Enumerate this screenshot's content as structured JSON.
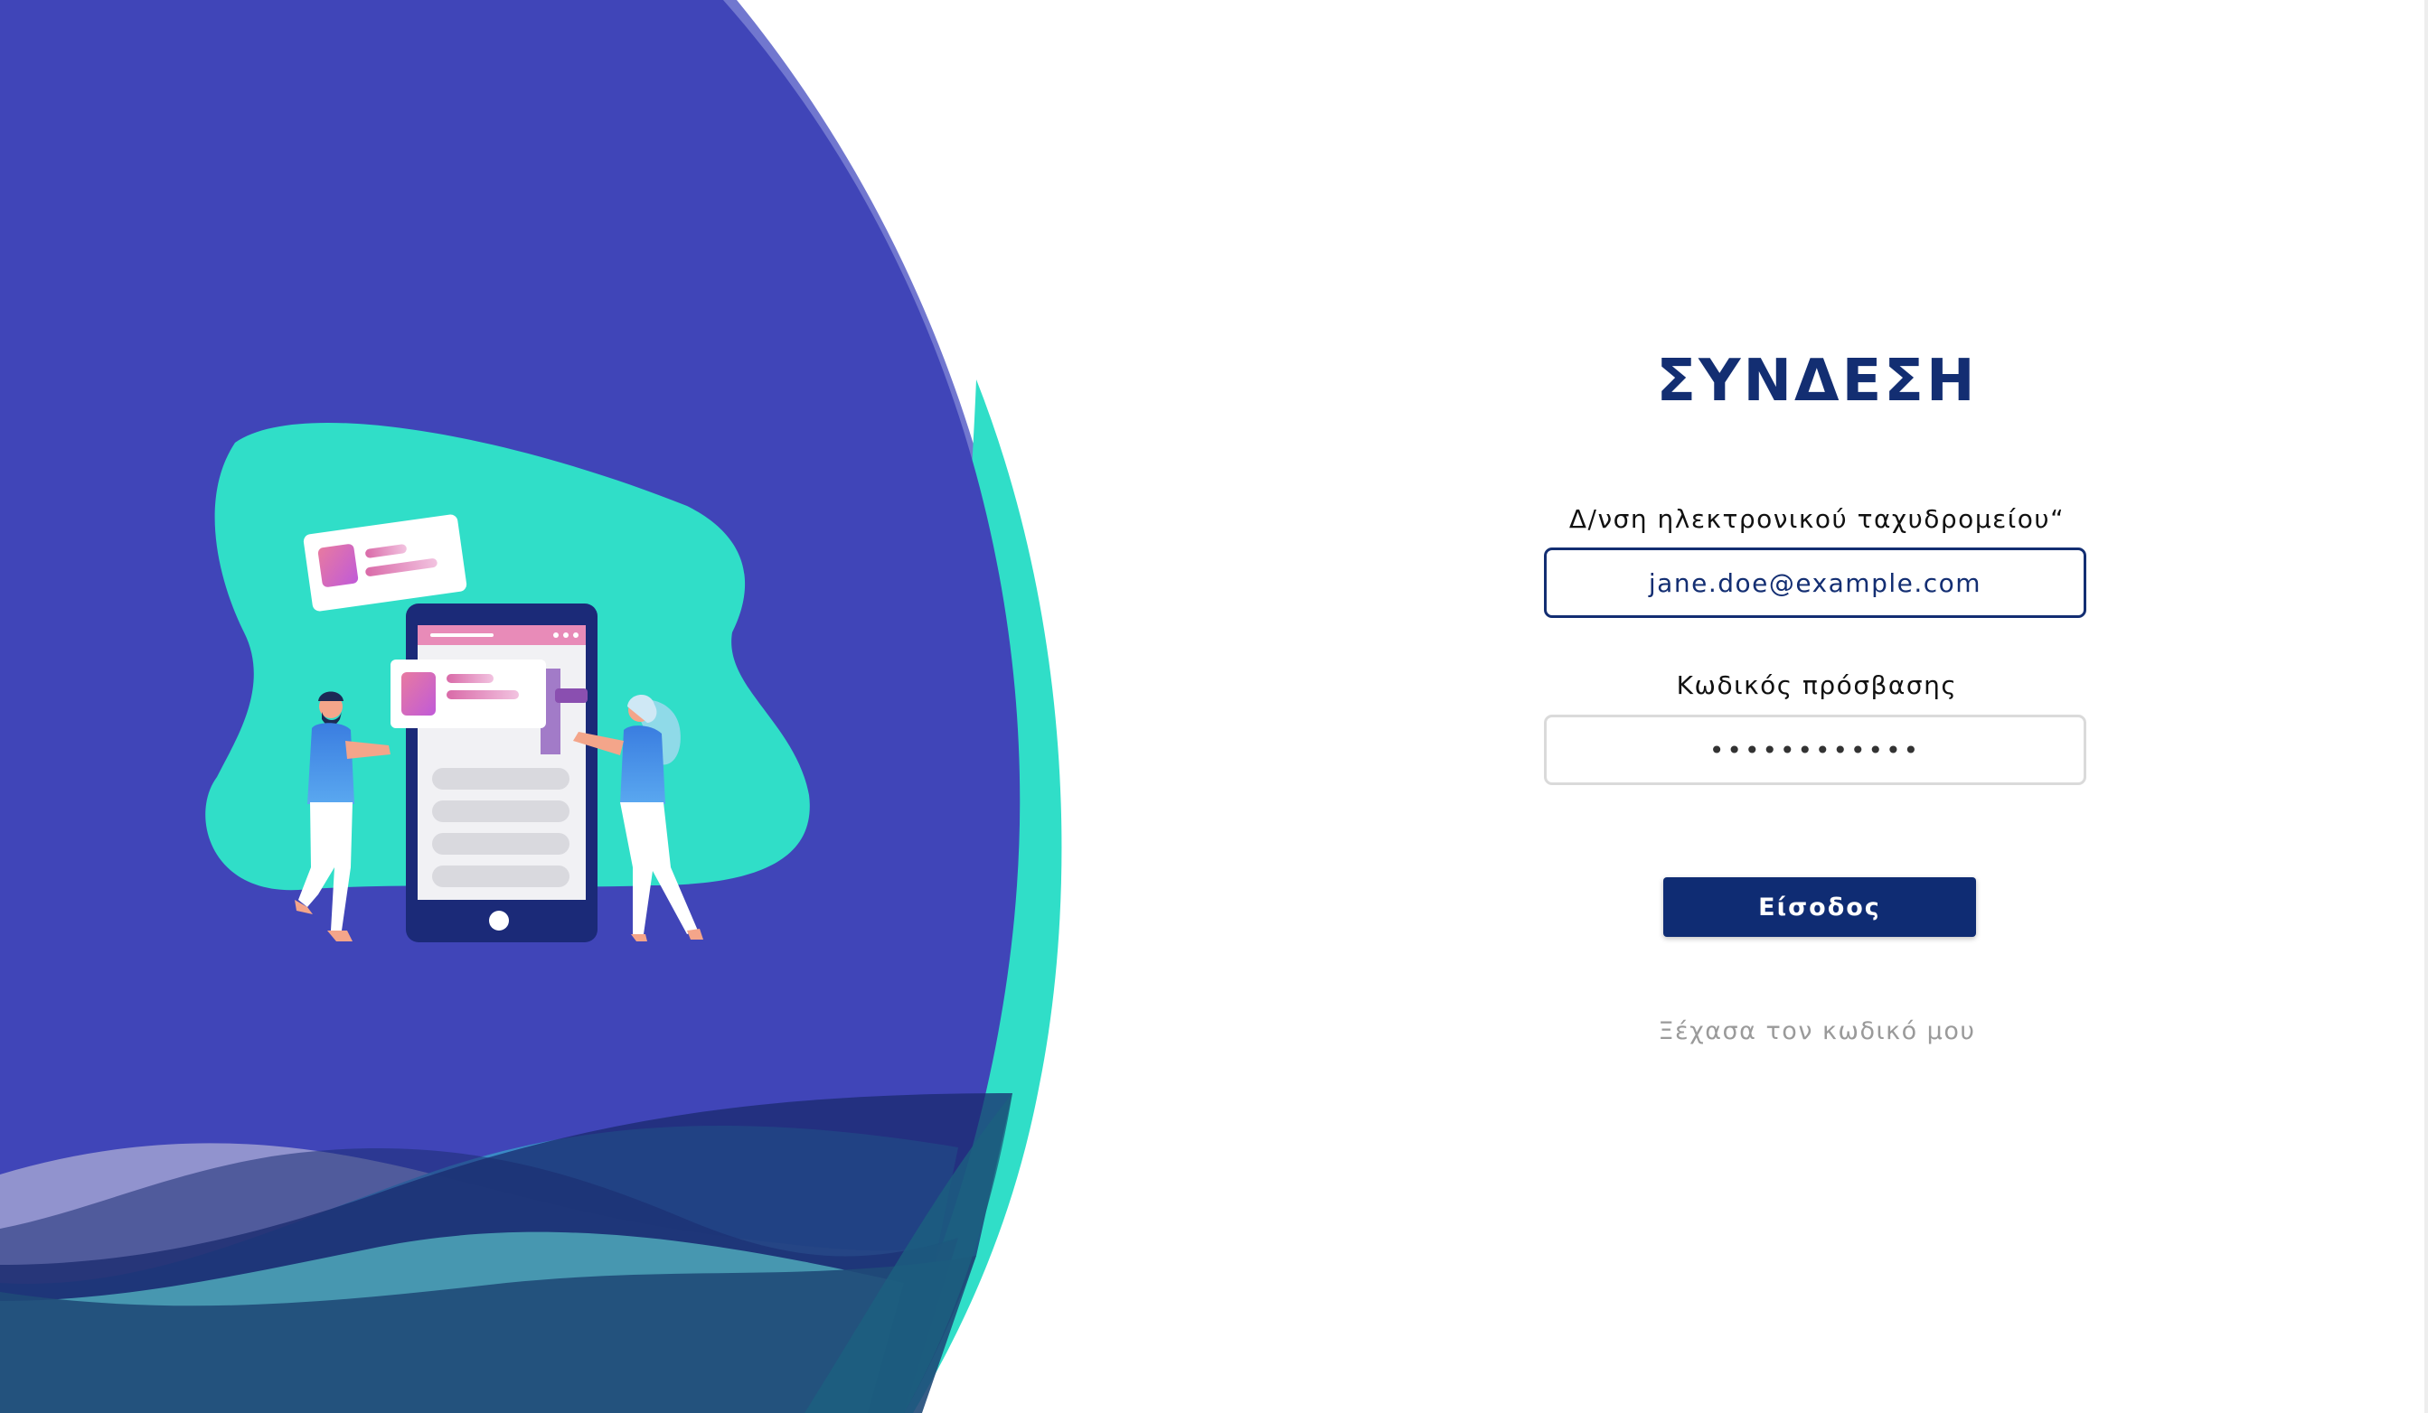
{
  "login": {
    "title": "ΣΥΝΔΕΣΗ",
    "email_label": "Δ/νση ηλεκτρονικού ταχυδρομείου“",
    "email_value": "jane.doe@example.com",
    "password_label": "Κωδικός πρόσβασης",
    "password_value": "••••••••••••",
    "submit_label": "Είσοδος",
    "forgot_label": "Ξέχασα τον κωδικό μου"
  },
  "colors": {
    "primary": "#132e72",
    "hero_background": "#4045b8",
    "accent_teal": "#30dec8",
    "link_gray": "#9a9a9a"
  },
  "illustration": {
    "icon": "people-with-phone-illustration"
  }
}
